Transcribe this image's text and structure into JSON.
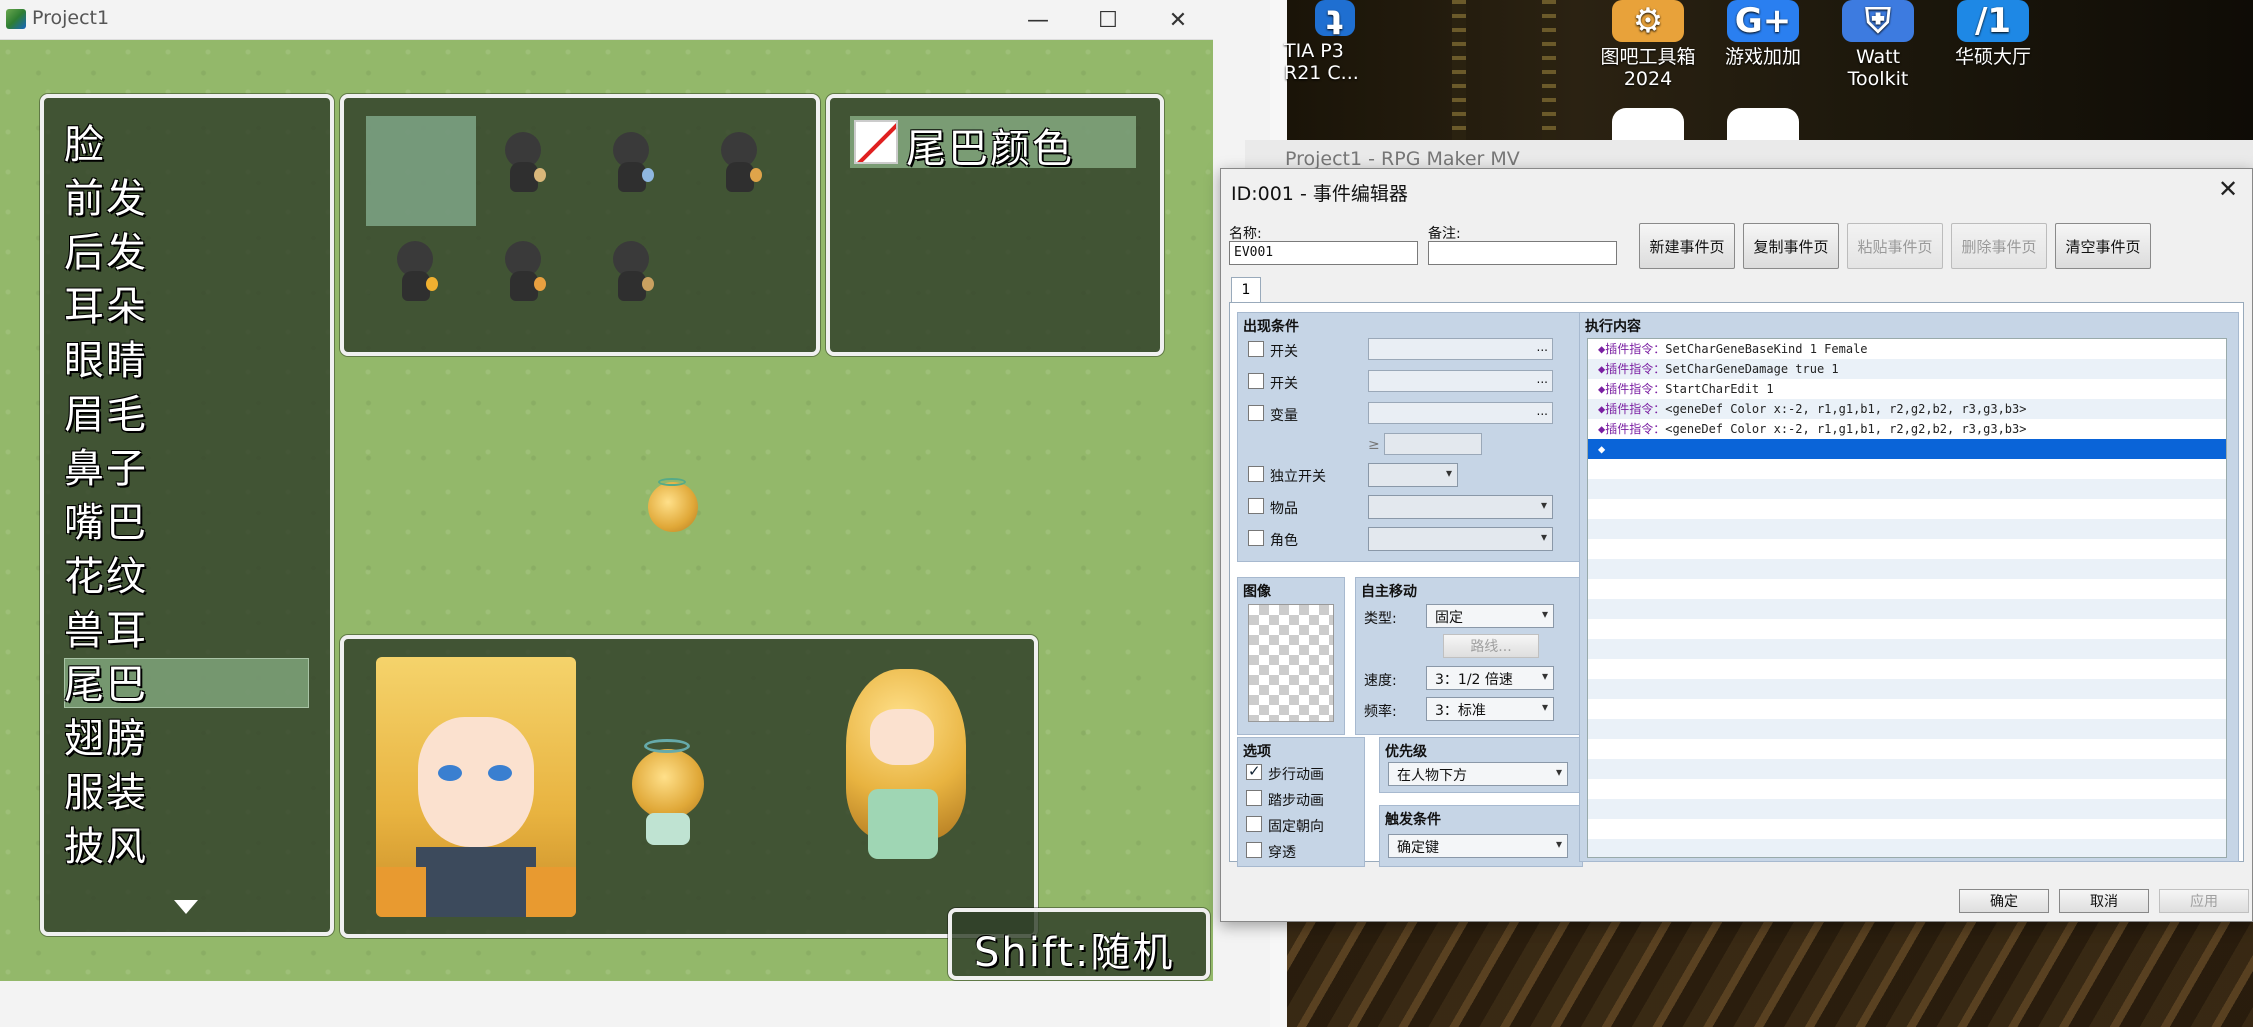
{
  "game_window": {
    "title": "Project1",
    "menu": [
      "脸",
      "前发",
      "后发",
      "耳朵",
      "眼睛",
      "眉毛",
      "鼻子",
      "嘴巴",
      "花纹",
      "兽耳",
      "尾巴",
      "翅膀",
      "服装",
      "披风"
    ],
    "selected_menu": "尾巴",
    "color_option": "尾巴颜色",
    "shift_hint": "Shift:随机"
  },
  "desktop": {
    "icons": [
      {
        "label": "TIA P3\nR21 C...",
        "color": "#1f6fd1",
        "glyph": "ʇ"
      },
      {
        "label": "图吧工具箱\n2024",
        "color": "#e8a23a",
        "glyph": "⚙"
      },
      {
        "label": "游戏加加",
        "color": "#2a7ff0",
        "glyph": "G+"
      },
      {
        "label": "Watt Toolkit",
        "color": "#3d7be0",
        "glyph": "⛨"
      },
      {
        "label": "华硕大厅",
        "color": "#1e88e5",
        "glyph": "/1"
      }
    ],
    "behind_window_title": "Project1 - RPG Maker MV"
  },
  "event_editor": {
    "title": "ID:001 - 事件编辑器",
    "name_label": "名称:",
    "name_value": "EV001",
    "note_label": "备注:",
    "note_value": "",
    "page_buttons": [
      {
        "label": "新建事件页",
        "enabled": true
      },
      {
        "label": "复制事件页",
        "enabled": true
      },
      {
        "label": "粘贴事件页",
        "enabled": false
      },
      {
        "label": "删除事件页",
        "enabled": false
      },
      {
        "label": "清空事件页",
        "enabled": true
      }
    ],
    "tab": "1",
    "conditions": {
      "title": "出现条件",
      "items": [
        "开关",
        "开关",
        "变量",
        "独立开关",
        "物品",
        "角色"
      ],
      "ge": "≥"
    },
    "image_title": "图像",
    "autonomous": {
      "title": "自主移动",
      "type_label": "类型:",
      "type_value": "固定",
      "route_button": "路线...",
      "speed_label": "速度:",
      "speed_value": "3：1/2 倍速",
      "freq_label": "频率:",
      "freq_value": "3：标准"
    },
    "options": {
      "title": "选项",
      "items": [
        {
          "label": "步行动画",
          "checked": true
        },
        {
          "label": "踏步动画",
          "checked": false
        },
        {
          "label": "固定朝向",
          "checked": false
        },
        {
          "label": "穿透",
          "checked": false
        }
      ]
    },
    "priority": {
      "title": "优先级",
      "value": "在人物下方"
    },
    "trigger": {
      "title": "触发条件",
      "value": "确定键"
    },
    "contents": {
      "title": "执行内容",
      "plugin_prefix": "◆插件指令：",
      "commands": [
        "SetCharGeneBaseKind 1 Female",
        "SetCharGeneDamage true 1",
        "StartCharEdit 1",
        "<geneDef Color x:-2, r1,g1,b1, r2,g2,b2, r3,g3,b3>",
        "<geneDef Color x:-2, r1,g1,b1, r2,g2,b2, r3,g3,b3>"
      ],
      "empty_marker": "◆"
    },
    "footer": {
      "ok": "确定",
      "cancel": "取消",
      "apply": "应用"
    }
  }
}
